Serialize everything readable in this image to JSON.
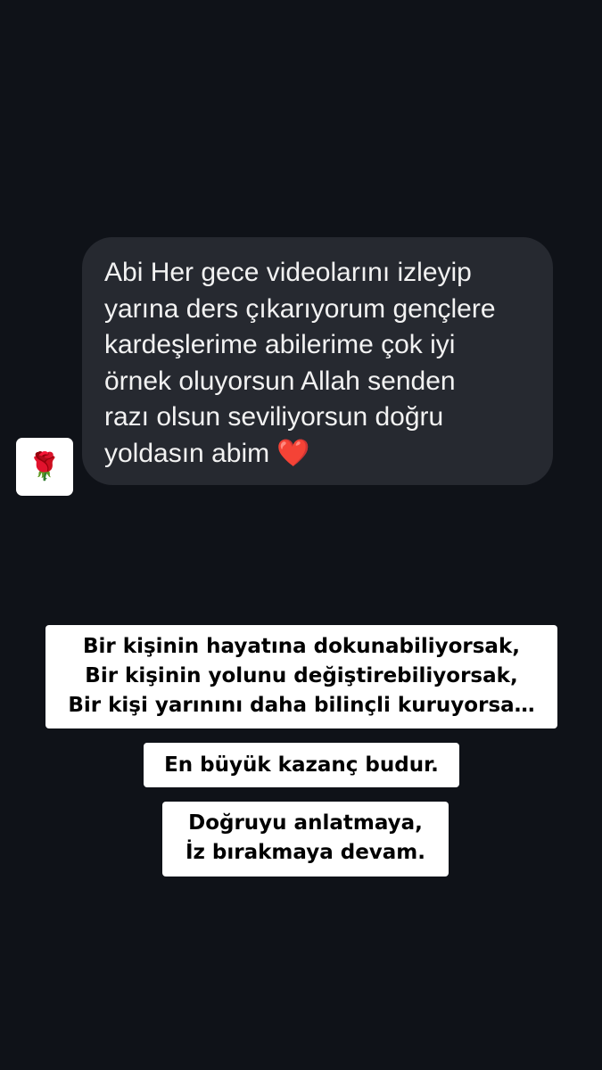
{
  "reply": {
    "avatar_emoji": "🌹",
    "message": "Abi  Her gece videolarını izleyip\nyarına ders çıkarıyorum gençlere\nkardeşlerime abilerime çok iyi\nörnek oluyorsun Allah senden\nrazı olsun seviliyorsun doğru\nyoldasın abim",
    "message_emoji": "❤️"
  },
  "captions": {
    "caption_1": "Bir kişinin hayatına dokunabiliyorsak,\nBir kişinin yolunu değiştirebiliyorsak,\nBir kişi yarınını daha bilinçli kuruyorsa…",
    "caption_2": "En büyük kazanç budur.",
    "caption_3": "Doğruyu anlatmaya,\nİz bırakmaya devam."
  },
  "colors": {
    "background": "#0f1218",
    "bubble": "#262930",
    "caption_bg": "#ffffff",
    "heart": "#e32a2a"
  }
}
